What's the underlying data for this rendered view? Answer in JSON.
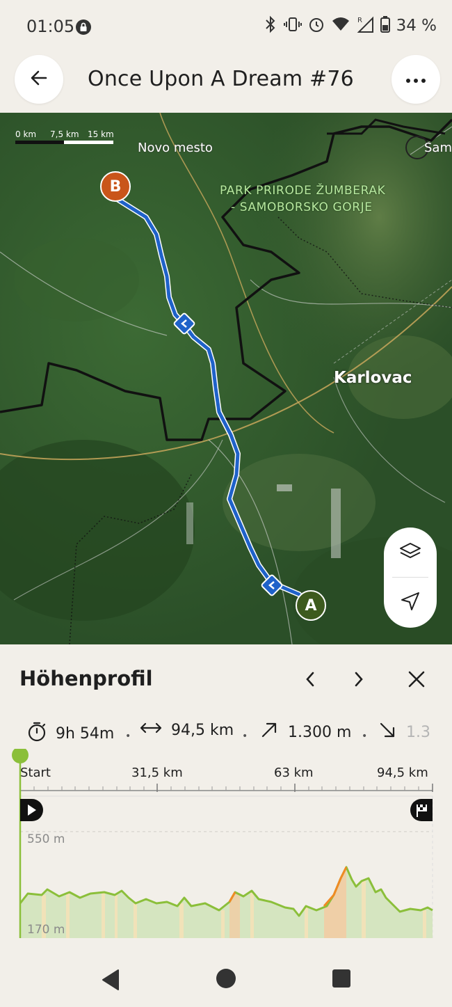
{
  "status_bar": {
    "time": "01:05",
    "battery": "34 %",
    "icons": [
      "lock-icon",
      "bluetooth-icon",
      "vibrate-icon",
      "alarm-icon",
      "wifi-icon",
      "signal-icon",
      "battery-icon"
    ]
  },
  "header": {
    "title": "Once Upon A Dream #76",
    "back_icon": "arrow-left-icon",
    "more_icon": "more-horizontal-icon"
  },
  "map": {
    "scale": [
      "0 km",
      "7,5 km",
      "15 km"
    ],
    "labels": {
      "novo_mesto": "Novo mesto",
      "park_line1": "PARK PRIRODE ŽUMBERAK",
      "park_line2": "- SAMOBORSKO GORJE",
      "karlovac": "Karlovac",
      "samobor_partial": "Sam"
    },
    "pin_start": "A",
    "pin_end": "B",
    "colors": {
      "route": "#1f62c9",
      "pin_start": "#3d5a1e",
      "pin_end": "#c9551a",
      "border": "#111111"
    },
    "controls": [
      "layers-icon",
      "locate-arrow-icon"
    ]
  },
  "panel": {
    "title": "Höhenprofil",
    "prev_icon": "chevron-left-icon",
    "next_icon": "chevron-right-icon",
    "close_icon": "close-icon",
    "stats": {
      "duration": "9h 54m",
      "distance": "94,5 km",
      "ascent": "1.300 m",
      "descent": "1.3"
    },
    "axis": {
      "start": "Start",
      "t1": "31,5 km",
      "t2": "63 km",
      "t3": "94,5 km"
    },
    "elevation": {
      "max": "550 m",
      "min": "170 m"
    },
    "colors": {
      "line": "#8bbf3a",
      "fill": "#d5e5c0",
      "steep": "#f08a24"
    }
  },
  "nav_bar": {
    "buttons": [
      "back-triangle-icon",
      "home-circle-icon",
      "recents-square-icon"
    ]
  }
}
